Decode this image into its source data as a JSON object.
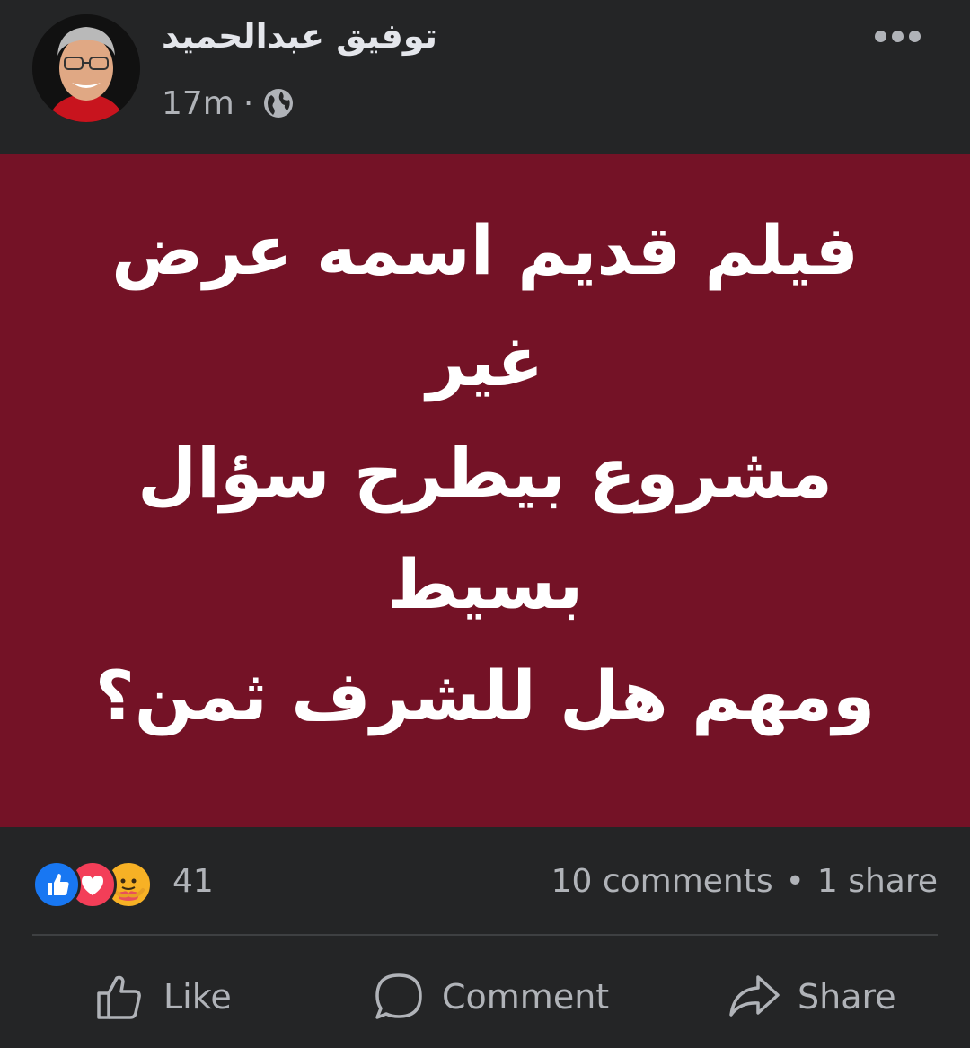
{
  "post": {
    "author_name": "توفيق عبدالحميد",
    "timestamp": "17m",
    "separator": "·",
    "privacy_icon": "globe-icon",
    "menu_icon": "more-horizontal-icon",
    "content": {
      "background_color": "#741226",
      "lines": [
        "فيلم قديم اسمه عرض غير",
        "مشروع بيطرح سؤال بسيط",
        "ومهم هل للشرف ثمن؟"
      ]
    },
    "reactions": {
      "icons": [
        "like-reaction-icon",
        "love-reaction-icon",
        "care-reaction-icon"
      ],
      "count": "41"
    },
    "engagement": {
      "comments": "10 comments",
      "dot": "•",
      "shares": "1 share"
    },
    "actions": {
      "like_label": "Like",
      "comment_label": "Comment",
      "share_label": "Share"
    },
    "colors": {
      "background": "#242526",
      "text_secondary": "#b0b3b8",
      "like_blue": "#1877f2",
      "love_red": "#f33e58",
      "care_yellow": "#f7b125"
    }
  }
}
